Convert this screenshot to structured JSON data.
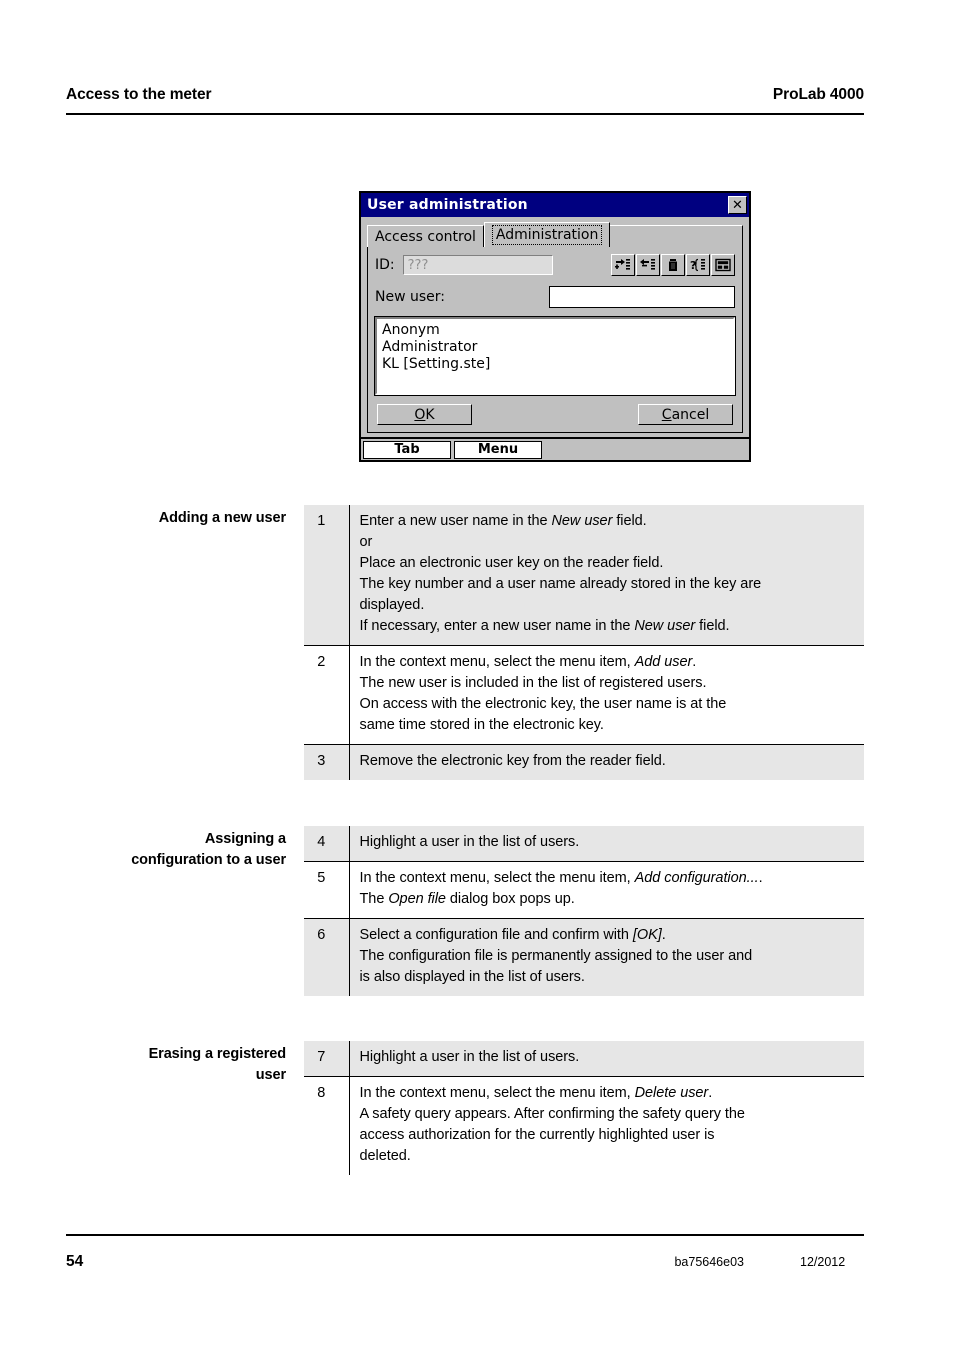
{
  "header": {
    "left": "Access to the meter",
    "right": "ProLab 4000"
  },
  "dialog": {
    "title": "User administration",
    "close_label": "✕",
    "tabs": [
      {
        "label": "Access control",
        "active": false
      },
      {
        "label": "Administration",
        "active": true
      }
    ],
    "id_label": "ID:",
    "id_value": "???",
    "new_user_label": "New user:",
    "new_user_value": "",
    "toolbar_buttons": [
      "add-user-icon",
      "remove-user-icon",
      "delete-user-icon",
      "user-properties-icon",
      "add-configuration-icon"
    ],
    "user_list": [
      "Anonym",
      "Administrator",
      "KL [Setting.ste]"
    ],
    "ok_label": "OK",
    "cancel_label": "Cancel",
    "taskbar": {
      "tab_label": "Tab",
      "menu_label": "Menu"
    }
  },
  "sections": [
    {
      "margin_label_lines": [
        "Adding a new user"
      ],
      "rows": [
        {
          "num": "1",
          "shaded": true,
          "lines": [
            "Enter a new user name in the <em>New user</em> field.",
            "or",
            "Place an electronic user key on the reader field.",
            "The key number and a user name already stored in the key are",
            "displayed.",
            "If necessary, enter a new user name in the <em>New user</em> field."
          ]
        },
        {
          "num": "2",
          "shaded": false,
          "lines": [
            "In the context menu, select the menu item, <em>Add user</em>.",
            "The new user is included in the list of registered users.",
            "On access with the electronic key, the user name is at the",
            "same time stored in the electronic key."
          ]
        },
        {
          "num": "3",
          "shaded": true,
          "lines": [
            "Remove the electronic key from the reader field."
          ]
        }
      ]
    },
    {
      "margin_label_lines": [
        "Assigning a",
        "configuration to a user"
      ],
      "rows": [
        {
          "num": "4",
          "shaded": true,
          "lines": [
            "Highlight a user in the list of users."
          ]
        },
        {
          "num": "5",
          "shaded": false,
          "lines": [
            "In the context menu, select the menu item, <em>Add configuration...</em>.",
            "The <em>Open file</em> dialog box pops up."
          ]
        },
        {
          "num": "6",
          "shaded": true,
          "lines": [
            "Select a configuration file and confirm with <em>[OK]</em>.",
            "The configuration file is permanently assigned to the user and",
            "is also displayed in the list of users."
          ]
        }
      ]
    },
    {
      "margin_label_lines": [
        "Erasing a registered",
        "user"
      ],
      "rows": [
        {
          "num": "7",
          "shaded": true,
          "lines": [
            "Highlight a user in the list of users."
          ]
        },
        {
          "num": "8",
          "shaded": false,
          "lines": [
            "In the context menu, select the menu item, <em>Delete user</em>.",
            "A safety query appears. After confirming the safety query the",
            "access authorization for the currently highlighted user is",
            "deleted."
          ]
        }
      ]
    }
  ],
  "footer": {
    "page": "54",
    "doc_number": "ba75646e03",
    "date": "12/2012"
  },
  "colors": {
    "titlebar": "#000080",
    "dialog_face": "#c0c0c0",
    "row_shade": "#e6e6e6"
  }
}
